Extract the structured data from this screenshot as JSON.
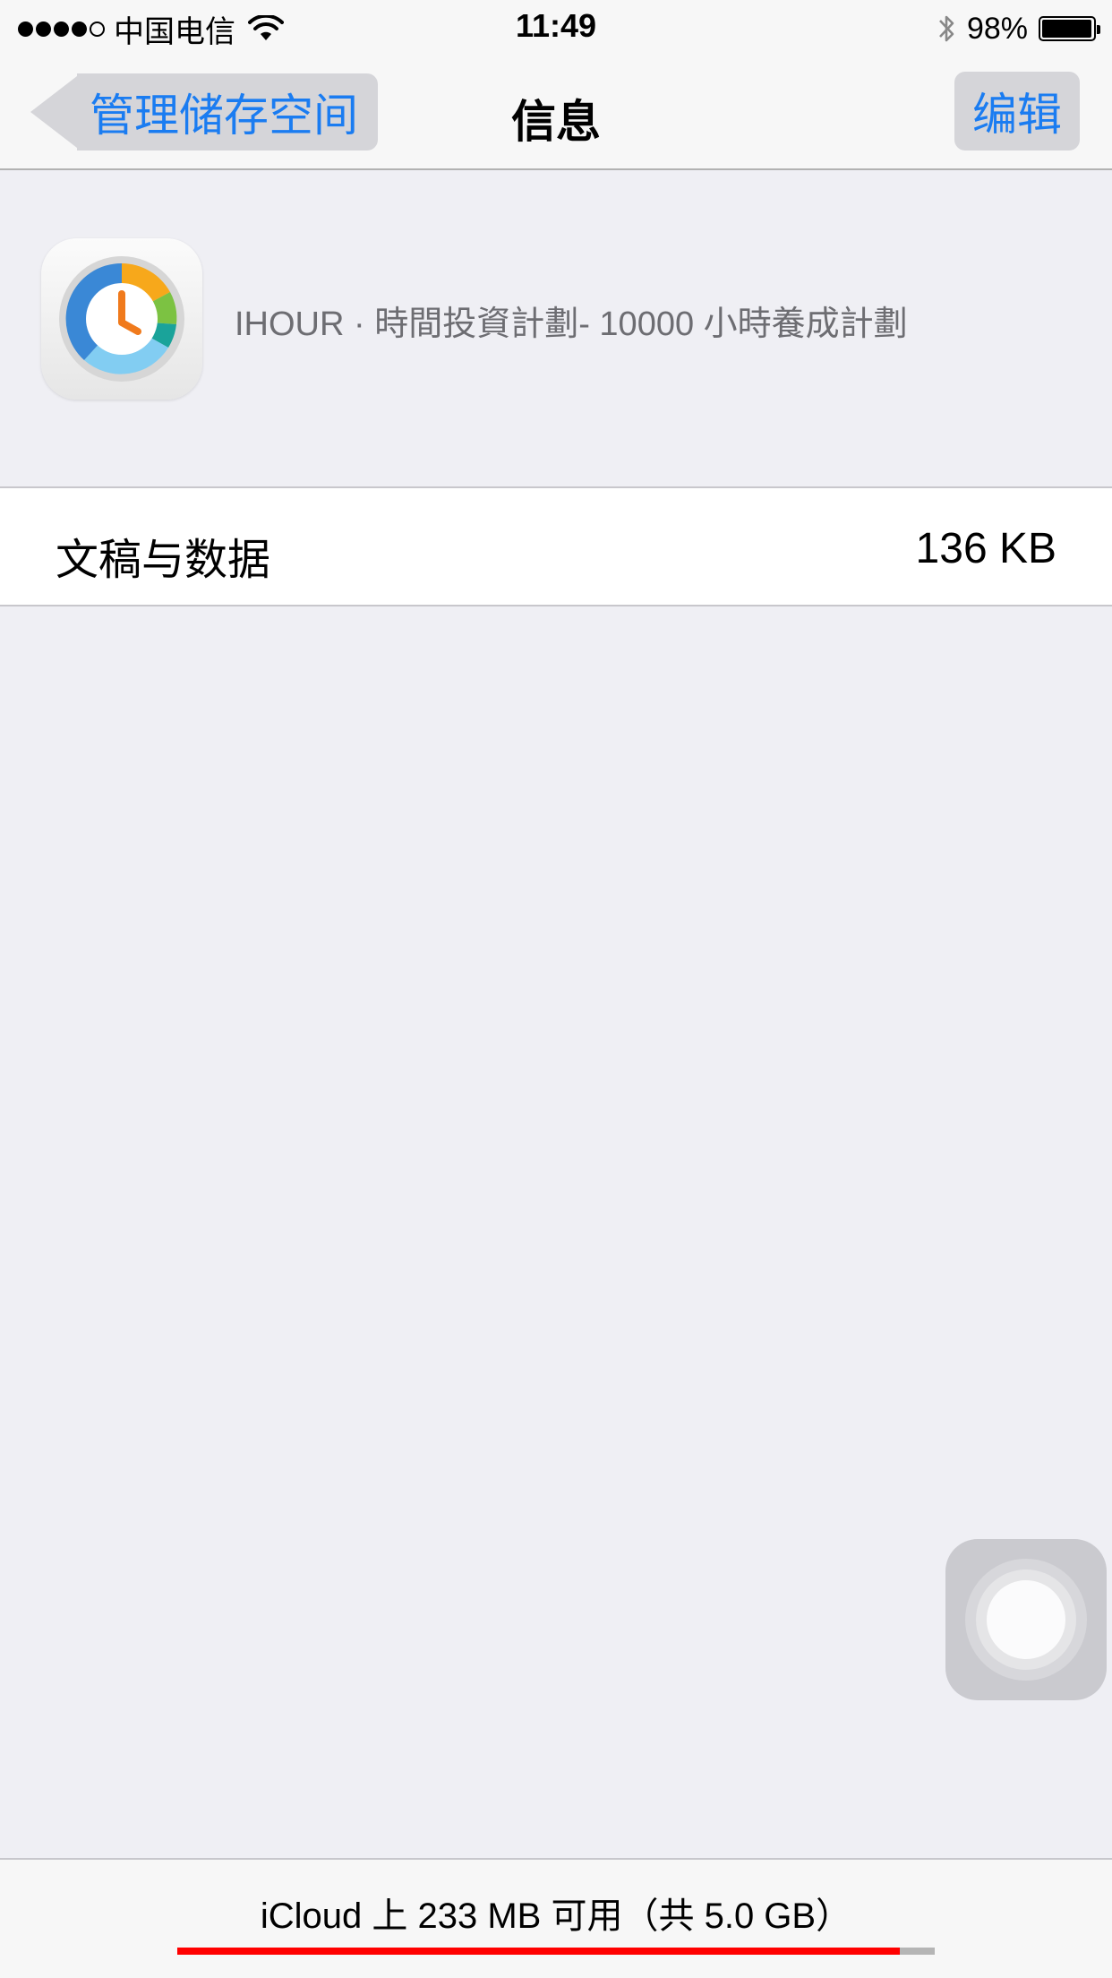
{
  "status_bar": {
    "carrier": "中国电信",
    "signal_bars": 5,
    "signal_filled": 4,
    "time": "11:49",
    "battery_percent": "98%",
    "battery_level": 0.98
  },
  "nav": {
    "back_label": "管理储存空间",
    "title": "信息",
    "edit_label": "编辑"
  },
  "app": {
    "name": "IHOUR · 時間投資計劃- 10000 小時養成計劃",
    "icon": "clock-pie-icon"
  },
  "rows": [
    {
      "label": "文稿与数据",
      "value": "136 KB"
    }
  ],
  "footer": {
    "storage_text": "iCloud 上 233 MB 可用（共 5.0 GB）",
    "used_fraction": 0.9534
  },
  "colors": {
    "accent": "#1a7cf1",
    "storage_used": "#ff0000",
    "background": "#efeff4"
  }
}
